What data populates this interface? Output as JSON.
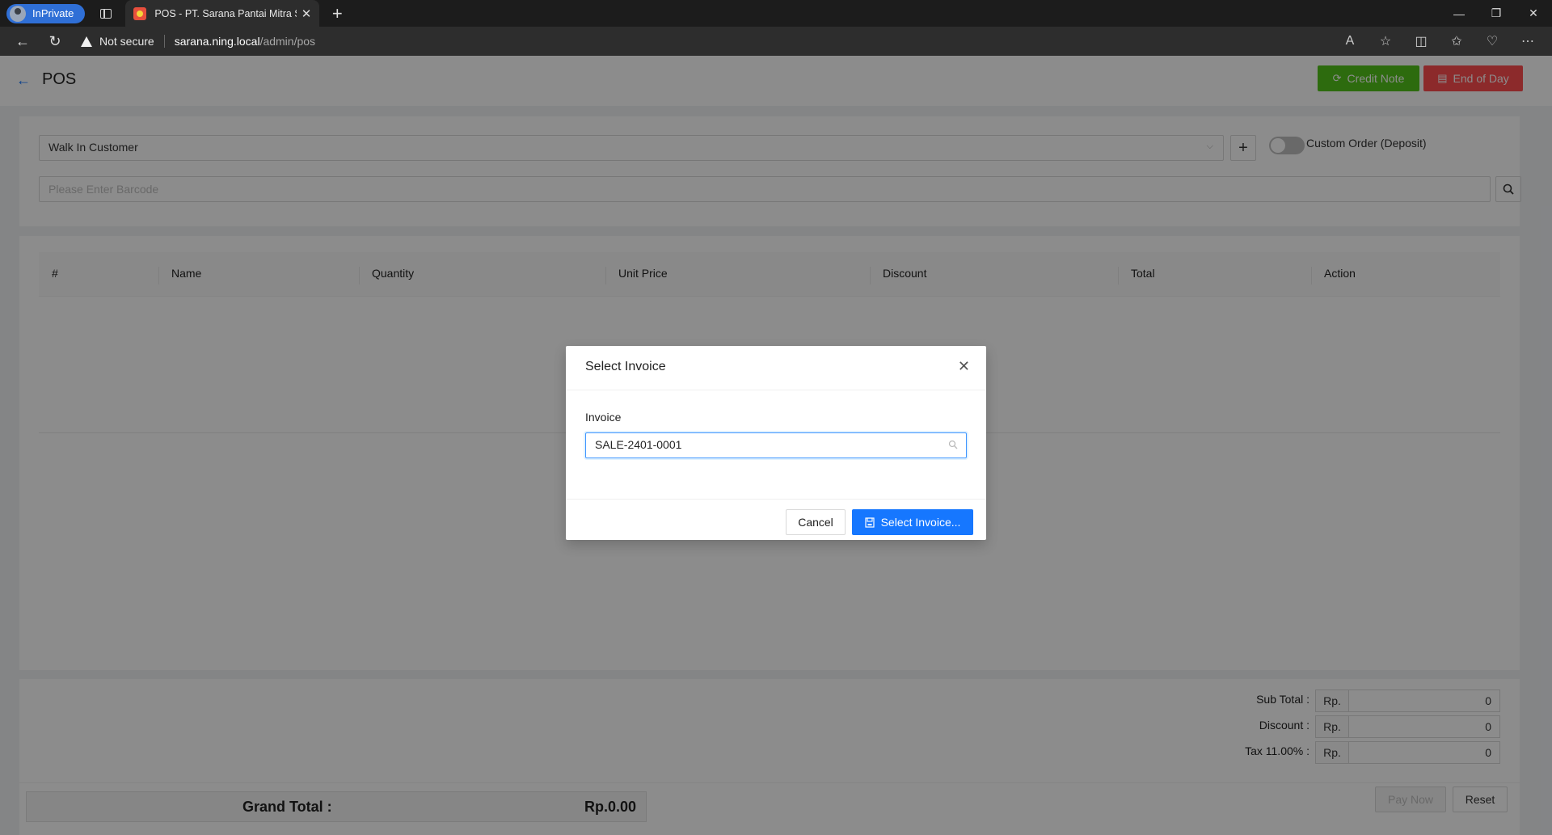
{
  "browser": {
    "inprivate_label": "InPrivate",
    "tab_title": "POS - PT. Sarana Pantai Mitra Se",
    "security_label": "Not secure",
    "url_host": "sarana.ning.local",
    "url_path": "/admin/pos"
  },
  "header": {
    "title": "POS",
    "credit_note_label": "Credit Note",
    "end_of_day_label": "End of Day"
  },
  "top": {
    "customer_value": "Walk In Customer",
    "custom_order_label": "Custom Order (Deposit)",
    "barcode_placeholder": "Please Enter Barcode"
  },
  "table": {
    "columns": [
      "#",
      "Name",
      "Quantity",
      "Unit Price",
      "Discount",
      "Total",
      "Action"
    ]
  },
  "summary": {
    "subtotal_label": "Sub Total :",
    "discount_label": "Discount :",
    "tax_label": "Tax 11.00% :",
    "currency_prefix": "Rp.",
    "subtotal_value": "0",
    "discount_value": "0",
    "tax_value": "0",
    "grand_total_label": "Grand Total :",
    "grand_total_value": "Rp.0.00",
    "pay_now_label": "Pay Now",
    "reset_label": "Reset"
  },
  "modal": {
    "title": "Select Invoice",
    "field_label": "Invoice",
    "invoice_value": "SALE-2401-0001",
    "cancel_label": "Cancel",
    "select_label": "Select Invoice..."
  },
  "colors": {
    "primary": "#1677ff",
    "success": "#52c41a",
    "danger": "#ff4d4f"
  }
}
